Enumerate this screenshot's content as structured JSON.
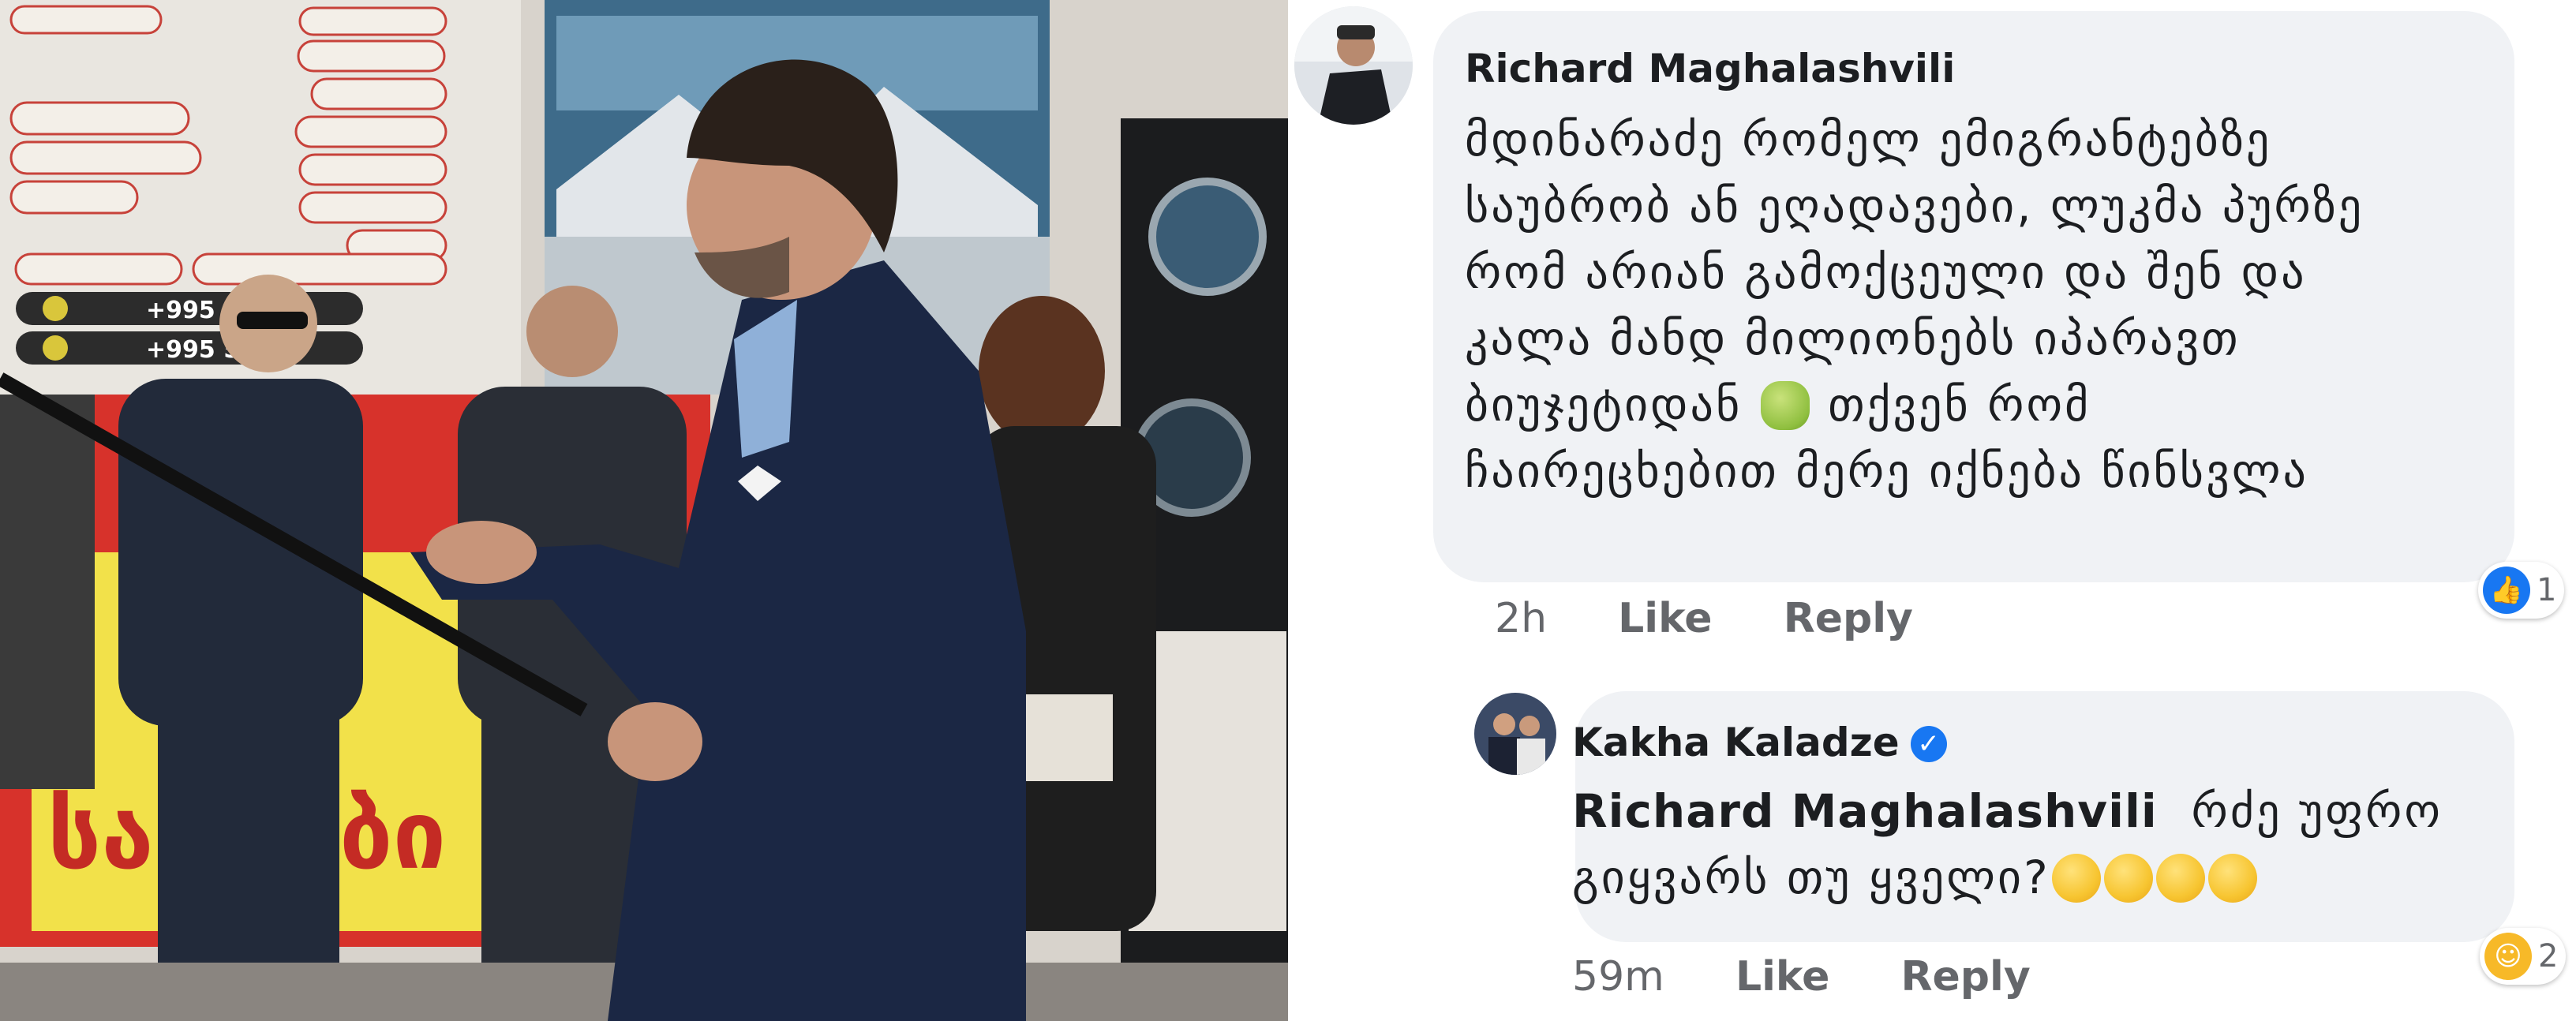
{
  "photo": {
    "board_phone_1": "+995 999",
    "board_phone_2": "+995 599",
    "banner_text_1": "სამა",
    "banner_text_2": "ბი"
  },
  "comments": [
    {
      "author": "Richard Maghalashvili",
      "verified": false,
      "lines": [
        "მდინარაძე რომელ ემიგრანტებზე",
        "საუბრობ ან ეღადავები, ლუკმა პურზე",
        "რომ არიან გამოქცეული და შენ და",
        "კალა მანდ მილიონებს იპარავთ",
        "ბიუჯეტიდან",
        "თქვენ რომ",
        "ჩაირეცხებით მერე იქნება წინსვლა"
      ],
      "inline_emoji": "facepalm",
      "time": "2h",
      "like_label": "Like",
      "reply_label": "Reply",
      "reaction": {
        "icon": "like-icon",
        "count": "1",
        "color": "#1877f2"
      }
    },
    {
      "author": "Kakha Kaladze",
      "verified": true,
      "mention": "Richard Maghalashvili",
      "text_after_mention": "რძე უფრო",
      "line2": "გიყვარს თუ ყველი?",
      "inline_emoji": "tears-of-joy",
      "time": "59m",
      "like_label": "Like",
      "reply_label": "Reply",
      "reaction": {
        "icon": "haha-icon",
        "count": "2",
        "color": "#f7b928"
      }
    }
  ]
}
